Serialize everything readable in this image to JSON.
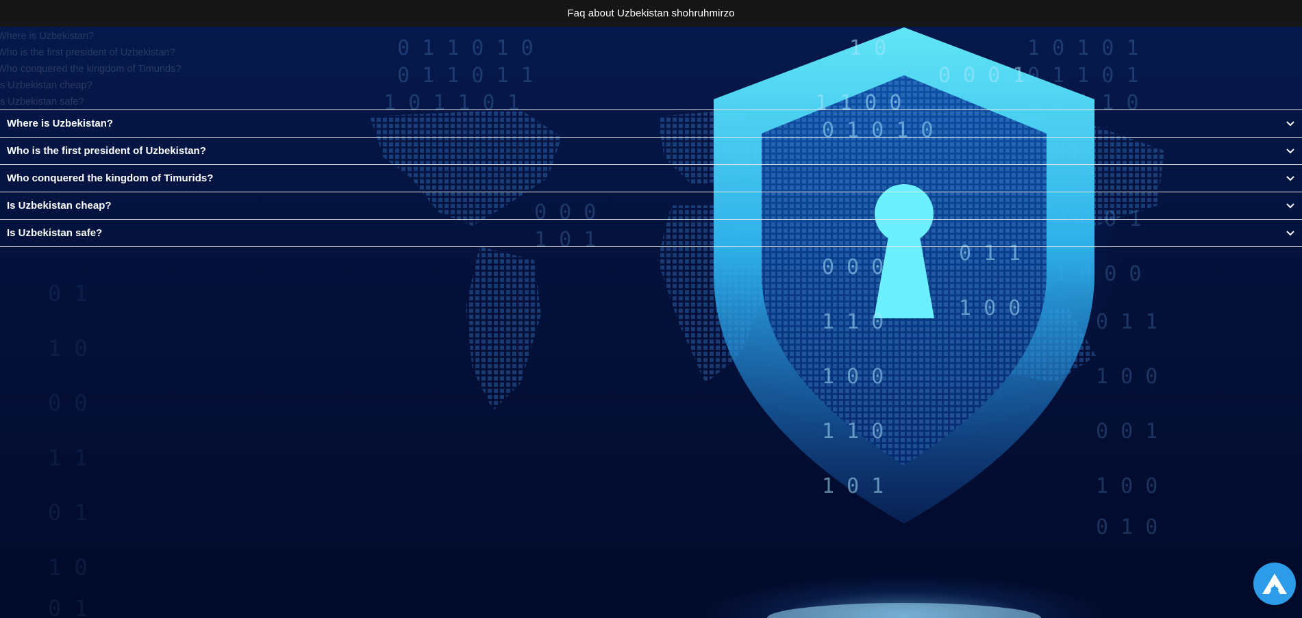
{
  "header": {
    "title": "Faq about Uzbekistan shohruhmirzo"
  },
  "quick_links": [
    {
      "label": "Where is Uzbekistan?"
    },
    {
      "label": "Who is the first president of Uzbekistan?"
    },
    {
      "label": "Who conquered the kingdom of Timurids?"
    },
    {
      "label": "Is Uzbekistan cheap?"
    },
    {
      "label": "Is Uzbekistan safe?"
    }
  ],
  "faq": {
    "items": [
      {
        "question": "Where is Uzbekistan?",
        "expanded": false
      },
      {
        "question": "Who is the first president of Uzbekistan?",
        "expanded": false
      },
      {
        "question": "Who conquered the kingdom of Timurids?",
        "expanded": false
      },
      {
        "question": "Is Uzbekistan cheap?",
        "expanded": false
      },
      {
        "question": "Is Uzbekistan safe?",
        "expanded": false
      }
    ]
  },
  "background": {
    "image": "cybersecurity-shield-keyhole",
    "colors": {
      "shield": "#5fe3ff",
      "shield_inner": "#1fa2e6",
      "keyhole": "#6cf0ff",
      "deep_blue": "#020a2a"
    }
  },
  "fab": {
    "icon": "app-logo-icon",
    "color": "#2c9be8"
  }
}
